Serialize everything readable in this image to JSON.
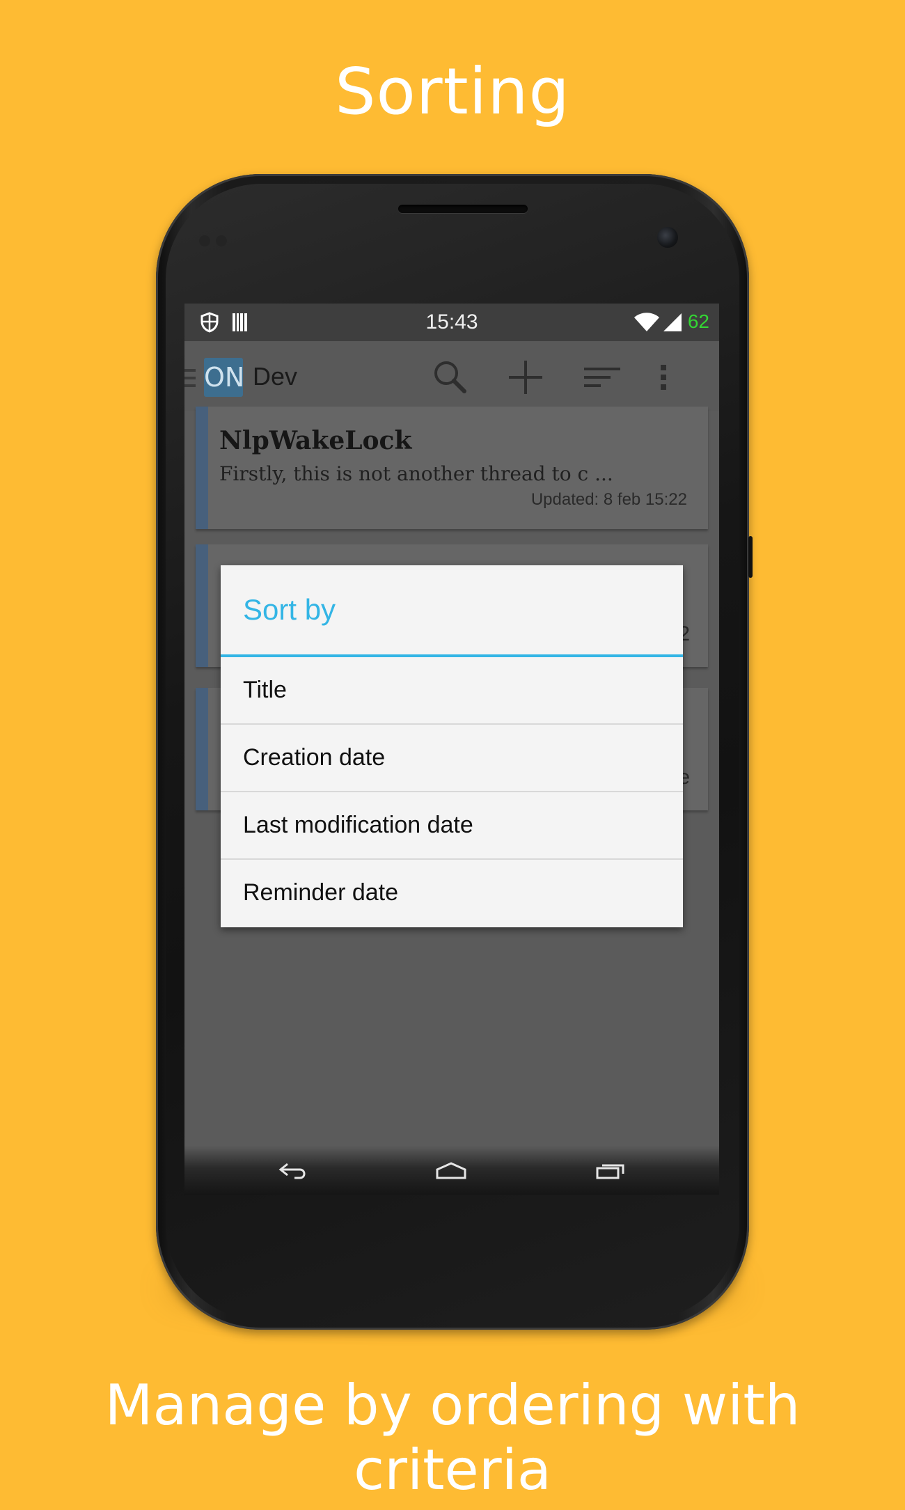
{
  "banner": {
    "title": "Sorting",
    "caption": "Manage by ordering with criteria"
  },
  "status_bar": {
    "time": "15:43",
    "battery": "62",
    "icons": [
      "shield-icon",
      "barcode-icon",
      "wifi-icon",
      "signal-icon"
    ]
  },
  "action_bar": {
    "app_logo_text": "ON",
    "title": "Dev",
    "actions": [
      "search-icon",
      "add-icon",
      "sort-icon",
      "overflow-menu-icon"
    ]
  },
  "notes": [
    {
      "title": "NlpWakeLock",
      "snippet": "Firstly, this is not another thread to c ...",
      "meta": "Updated: 8 feb 15:22"
    },
    {
      "edge_glyph": "2"
    },
    {
      "edge_glyph": "e"
    }
  ],
  "dialog": {
    "title": "Sort by",
    "options": [
      "Title",
      "Creation date",
      "Last modification date",
      "Reminder date"
    ]
  },
  "nav_bar": {
    "icons": [
      "back-icon",
      "home-icon",
      "recent-apps-icon"
    ]
  },
  "colors": {
    "background": "#FEBB33",
    "accent": "#33b5e5",
    "note_color_bar": "#47607c",
    "battery_text": "#33d633"
  }
}
